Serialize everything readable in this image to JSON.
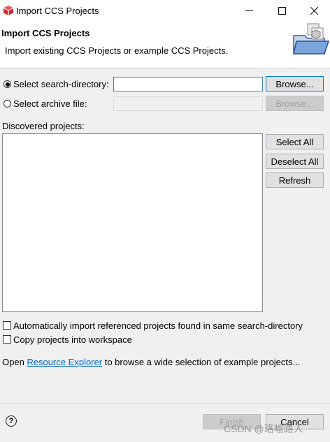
{
  "window": {
    "title": "Import CCS Projects",
    "controls": {
      "minimize": "—",
      "maximize": "☐",
      "close": "✕"
    }
  },
  "header": {
    "title": "Import CCS Projects",
    "description": "Import existing CCS Projects or example CCS Projects."
  },
  "source": {
    "search_dir_label": "Select search-directory:",
    "search_dir_value": "",
    "search_dir_selected": true,
    "archive_label": "Select archive file:",
    "archive_value": "",
    "archive_selected": false,
    "browse_label": "Browse...",
    "browse_disabled_label": "Browse..."
  },
  "projects": {
    "label": "Discovered projects:",
    "items": [],
    "select_all": "Select All",
    "deselect_all": "Deselect All",
    "refresh": "Refresh"
  },
  "options": {
    "auto_import_label": "Automatically import referenced projects found in same search-directory",
    "auto_import_checked": false,
    "copy_label": "Copy projects into workspace",
    "copy_checked": false
  },
  "explorer": {
    "prefix": "Open",
    "link": "Resource Explorer",
    "suffix": "to browse a wide selection of example projects..."
  },
  "footer": {
    "help": "?",
    "finish": "Finish",
    "cancel": "Cancel"
  },
  "watermark": "CSDN @珞喻路人",
  "colors": {
    "accent": "#0078d7",
    "link": "#0066cc",
    "app_icon": "#d0282e"
  }
}
